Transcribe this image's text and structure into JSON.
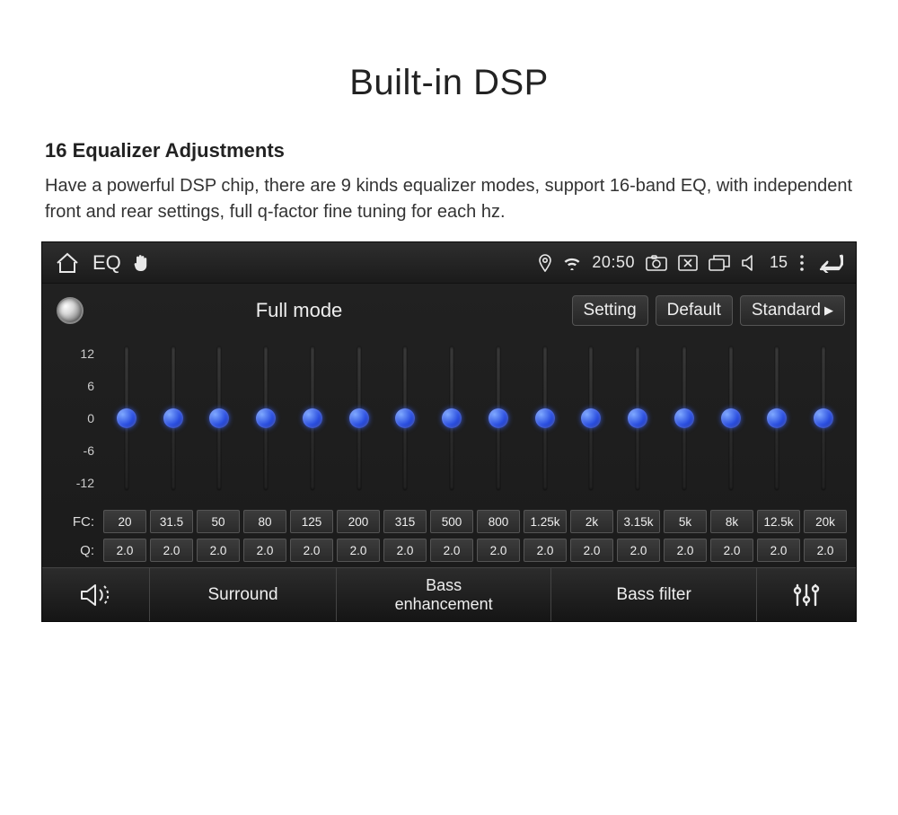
{
  "page": {
    "title": "Built-in DSP",
    "subtitle": "16 Equalizer Adjustments",
    "description": "Have a powerful DSP chip, there are 9 kinds equalizer modes, support 16-band EQ, with independent front and rear settings, full q-factor fine tuning for each hz."
  },
  "statusbar": {
    "eq_label": "EQ",
    "clock": "20:50",
    "volume": "15"
  },
  "controls": {
    "mode_label": "Full mode",
    "setting_label": "Setting",
    "default_label": "Default",
    "preset_label": "Standard"
  },
  "eq": {
    "scale": [
      "12",
      "6",
      "0",
      "-6",
      "-12"
    ],
    "band_value": 0,
    "fc_label": "FC:",
    "q_label": "Q:",
    "fc": [
      "20",
      "31.5",
      "50",
      "80",
      "125",
      "200",
      "315",
      "500",
      "800",
      "1.25k",
      "2k",
      "3.15k",
      "5k",
      "8k",
      "12.5k",
      "20k"
    ],
    "q": [
      "2.0",
      "2.0",
      "2.0",
      "2.0",
      "2.0",
      "2.0",
      "2.0",
      "2.0",
      "2.0",
      "2.0",
      "2.0",
      "2.0",
      "2.0",
      "2.0",
      "2.0",
      "2.0"
    ]
  },
  "tabs": {
    "surround": "Surround",
    "bass_enh_1": "Bass",
    "bass_enh_2": "enhancement",
    "bass_filter": "Bass filter"
  }
}
